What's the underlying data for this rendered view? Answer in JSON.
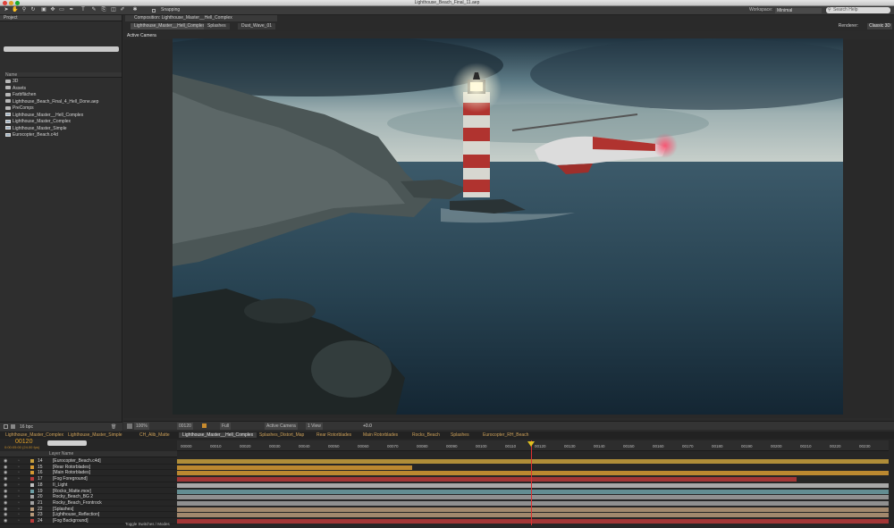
{
  "window": {
    "title": "Lighthouse_Beach_Final_11.aep"
  },
  "toolbar": {
    "snapping_label": "Snapping",
    "workspace_label": "Workspace:",
    "workspace_value": "Minimal",
    "search_placeholder": "Search Help"
  },
  "project": {
    "panel_title": "Project",
    "column_name": "Name",
    "bpc": "16 bpc",
    "items": [
      {
        "label": "3D",
        "type": "folder"
      },
      {
        "label": "Assets",
        "type": "folder"
      },
      {
        "label": "Farbflächen",
        "type": "folder"
      },
      {
        "label": "Lighthouse_Beach_Final_4_Hell_Done.aep",
        "type": "folder"
      },
      {
        "label": "PreComps",
        "type": "folder"
      },
      {
        "label": "Lighthouse_Master__Hell_Complex",
        "type": "comp"
      },
      {
        "label": "Lighthouse_Master_Complex",
        "type": "comp"
      },
      {
        "label": "Lighthouse_Master_Simple",
        "type": "comp"
      },
      {
        "label": "Eurocopter_Beach.c4d",
        "type": "file"
      }
    ]
  },
  "composition": {
    "panel_label": "Composition: Lighthouse_Master__Hell_Complex",
    "tabs": [
      "Lighthouse_Master__Hell_Complex",
      "Splashes",
      "Dust_Wave_01"
    ],
    "renderer_label": "Renderer:",
    "renderer_value": "Classic 3D",
    "camera_label": "Active Camera"
  },
  "viewer_controls": {
    "zoom": "100%",
    "timecode": "00120",
    "resolution": "Full",
    "camera": "Active Camera",
    "views": "1 View",
    "exposure": "+0.0"
  },
  "timeline": {
    "tabs": [
      "Lighthouse_Master_Complex",
      "Lighthouse_Master_Simple",
      "CH_Alib_Matte",
      "Lighthouse_Master__Hell_Complex",
      "Splashes_Distort_Map",
      "Rear Rotorblades",
      "Main Rotorblades",
      "Rocks_Beach",
      "Splashes",
      "Eurocopter_RH_Beach"
    ],
    "current_time": "00120",
    "fps_label": "0:00:05:00 (24.00 fps)",
    "column_header": "Layer Name",
    "ruler": [
      "00000",
      "00010",
      "00020",
      "00030",
      "00040",
      "00050",
      "00060",
      "00070",
      "00080",
      "00090",
      "00100",
      "00110",
      "00120",
      "00130",
      "00140",
      "00150",
      "00160",
      "00170",
      "00180",
      "00190",
      "00200",
      "00210",
      "00220",
      "00230"
    ],
    "footer": "Toggle Switches / Modes",
    "layers": [
      {
        "num": "14",
        "name": "[Eurocopter_Beach.c4d]",
        "color": "#c8a03c"
      },
      {
        "num": "15",
        "name": "[Rear Rotorblades]",
        "color": "#d69a32"
      },
      {
        "num": "16",
        "name": "[Main Rotorblades]",
        "color": "#d69a32"
      },
      {
        "num": "17",
        "name": "[Fog Foreground]",
        "color": "#b83a3a"
      },
      {
        "num": "18",
        "name": "II_Light",
        "color": "#c0c0c0"
      },
      {
        "num": "19",
        "name": "[Rocks_Matte.mov]",
        "color": "#6ea0a6"
      },
      {
        "num": "20",
        "name": "Rocky_Beach_BG 2",
        "color": "#a3a3a3"
      },
      {
        "num": "21",
        "name": "Rocky_Beach_Frontrock",
        "color": "#a3a3a3"
      },
      {
        "num": "22",
        "name": "[Splashes]",
        "color": "#b89a7a"
      },
      {
        "num": "23",
        "name": "[Lighthouse_Reflection]",
        "color": "#b89a7a"
      },
      {
        "num": "24",
        "name": "[Fog Background]",
        "color": "#b83a3a"
      }
    ]
  }
}
